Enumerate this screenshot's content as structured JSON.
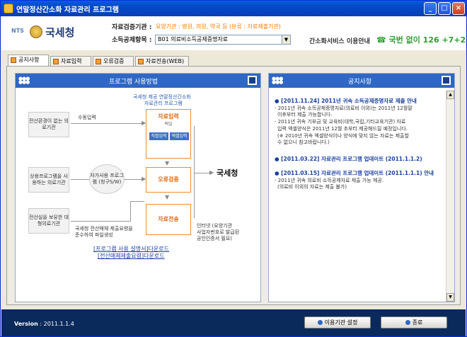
{
  "window": {
    "title": "연말정산간소화 자료관리 프로그램"
  },
  "header": {
    "logo_prefix": "NTS",
    "logo_name": "국세청",
    "agency_label": "자료검증기관 :",
    "agency_value": "요양기관 : 병원, 의원, 약국 등 (분류 : 자료제출기관)",
    "deduction_label": "소득공제항목 :",
    "deduction_value": "B01 의료비소득공제증명자료",
    "service_text": "간소화서비스 이용안내",
    "phone_text": "국번 없이  126 +7+2"
  },
  "tabs": [
    {
      "label": "공지사항",
      "active": true
    },
    {
      "label": "자료입력",
      "active": false
    },
    {
      "label": "오류검증",
      "active": false
    },
    {
      "label": "자료전송(WEB)",
      "active": false
    }
  ],
  "left_panel": {
    "title": "프로그램 사용방법",
    "caption_line1": "국세청 제공 연말정산간소화",
    "caption_line2": "자료관리 프로그램",
    "inst1": "전산환경이 없는 의료기관",
    "inst2": "상용프로그램을 사용하는 의료기관",
    "inst3": "전산실을 보유한 대형의료기관",
    "manual_input": "수동입력",
    "self_program": "자가사용 프로그램 (청구S/W)",
    "step_input": "자료입력",
    "choose": "택일",
    "sub_direct": "직접입력",
    "sub_excel": "엑셀입력",
    "step_verify": "오류검증",
    "step_send": "자료전송",
    "nts": "국세청",
    "note_left1": "국세청 전산매체 제출요령을",
    "note_left2": "준수하여 파일생성",
    "note_right1": "인터넷 (요양기관",
    "note_right2": "사업자번호로 발급된",
    "note_right3": "공인인증서 필요)",
    "link1": "[프로그램 사용 설명서]다운로드",
    "link2": "[전산매체제출요령]다운로드"
  },
  "right_panel": {
    "title": "공지사항",
    "notices": [
      {
        "title": "[2011.11.24] 2011년 귀속 소득공제증명자료 제출 안내",
        "body": [
          "- 2011년 귀속 소득공제증명자료(의료비 이외)는 2011년 12월말",
          "이후부터 제출 가능합니다.",
          "- 2011년 귀속 기부금 및 교육비(대학,국립,기타교육기관) 자료",
          "입력 엑셀양식은 2011년 12월 초부터 제공해드릴 예정입니다.",
          "(※ 2010년 귀속 엑셀양식이나 양식에 맞지 않는 자료는 제출할",
          "수 없으니 참고바랍니다.)"
        ]
      },
      {
        "title": "[2011.03.22] 자료관리 프로그램 업데이트 (2011.1.1.2)",
        "body": []
      },
      {
        "title": "[2011.03.15] 자료관리 프로그램 업데이트 (2011.1.1.1) 안내",
        "body": [
          "- 2011년 귀속 의료비 소득공제자료 제출 가능 제공.",
          "(의료비 이외의 자료는 제출 불가)"
        ]
      }
    ]
  },
  "footer": {
    "version_label": "Version",
    "version_value": ": 2011.1.1.4",
    "btn_setup": "이용기관 설정",
    "btn_exit": "종료"
  }
}
